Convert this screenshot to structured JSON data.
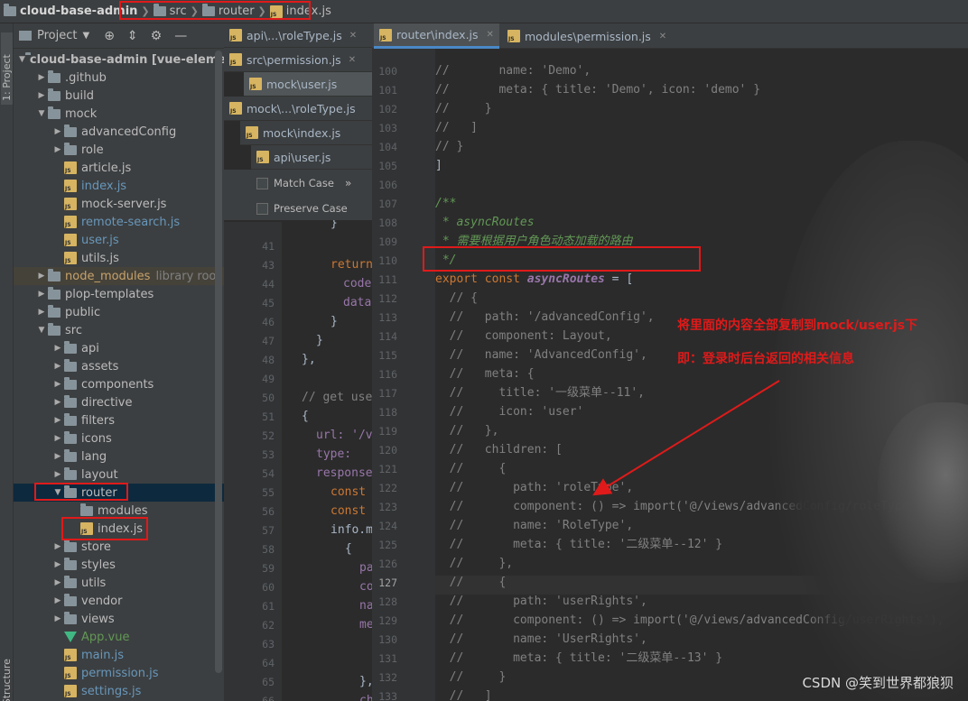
{
  "breadcrumb": {
    "project": "cloud-base-admin",
    "folders": [
      "src",
      "router"
    ],
    "file": "index.js"
  },
  "side_tabs": {
    "project": "1: Project",
    "structure": "Z: Structure"
  },
  "project_panel": {
    "title": "Project",
    "tools": [
      "⊕",
      "⇕",
      "⚙",
      "—"
    ],
    "tree": [
      {
        "label": "cloud-base-admin [vue-element-admin]",
        "depth": 0,
        "kind": "folder",
        "open": true,
        "bold": true
      },
      {
        "label": ".github",
        "depth": 1,
        "kind": "folder"
      },
      {
        "label": "build",
        "depth": 1,
        "kind": "folder"
      },
      {
        "label": "mock",
        "depth": 1,
        "kind": "folder",
        "open": true
      },
      {
        "label": "advancedConfig",
        "depth": 2,
        "kind": "folder"
      },
      {
        "label": "role",
        "depth": 2,
        "kind": "folder"
      },
      {
        "label": "article.js",
        "depth": 2,
        "kind": "js"
      },
      {
        "label": "index.js",
        "depth": 2,
        "kind": "js",
        "blue": true
      },
      {
        "label": "mock-server.js",
        "depth": 2,
        "kind": "js"
      },
      {
        "label": "remote-search.js",
        "depth": 2,
        "kind": "js",
        "blue": true
      },
      {
        "label": "user.js",
        "depth": 2,
        "kind": "js",
        "blue": true
      },
      {
        "label": "utils.js",
        "depth": 2,
        "kind": "js"
      },
      {
        "label": "node_modules",
        "depth": 1,
        "kind": "folder",
        "excluded": true,
        "suffix": "library root"
      },
      {
        "label": "plop-templates",
        "depth": 1,
        "kind": "folder"
      },
      {
        "label": "public",
        "depth": 1,
        "kind": "folder"
      },
      {
        "label": "src",
        "depth": 1,
        "kind": "folder",
        "open": true
      },
      {
        "label": "api",
        "depth": 2,
        "kind": "folder"
      },
      {
        "label": "assets",
        "depth": 2,
        "kind": "folder"
      },
      {
        "label": "components",
        "depth": 2,
        "kind": "folder"
      },
      {
        "label": "directive",
        "depth": 2,
        "kind": "folder"
      },
      {
        "label": "filters",
        "depth": 2,
        "kind": "folder"
      },
      {
        "label": "icons",
        "depth": 2,
        "kind": "folder"
      },
      {
        "label": "lang",
        "depth": 2,
        "kind": "folder"
      },
      {
        "label": "layout",
        "depth": 2,
        "kind": "folder"
      },
      {
        "label": "router",
        "depth": 2,
        "kind": "folder",
        "open": true,
        "selected": true
      },
      {
        "label": "modules",
        "depth": 3,
        "kind": "folder",
        "noarrow": true
      },
      {
        "label": "index.js",
        "depth": 3,
        "kind": "js"
      },
      {
        "label": "store",
        "depth": 2,
        "kind": "folder"
      },
      {
        "label": "styles",
        "depth": 2,
        "kind": "folder"
      },
      {
        "label": "utils",
        "depth": 2,
        "kind": "folder"
      },
      {
        "label": "vendor",
        "depth": 2,
        "kind": "folder"
      },
      {
        "label": "views",
        "depth": 2,
        "kind": "folder"
      },
      {
        "label": "App.vue",
        "depth": 2,
        "kind": "vue",
        "green": true
      },
      {
        "label": "main.js",
        "depth": 2,
        "kind": "js",
        "blue": true
      },
      {
        "label": "permission.js",
        "depth": 2,
        "kind": "js",
        "blue": true
      },
      {
        "label": "settings.js",
        "depth": 2,
        "kind": "js",
        "blue": true
      }
    ]
  },
  "mid_tabs": [
    {
      "label": "api\\...\\roleType.js"
    },
    {
      "label": "src\\permission.js"
    },
    {
      "label": "mock\\user.js",
      "active": true
    },
    {
      "label": "mock\\...\\roleType.js"
    },
    {
      "label": "mock\\index.js"
    },
    {
      "label": "api\\user.js"
    }
  ],
  "find_options": {
    "match_case": "Match Case",
    "preserve_case": "Preserve Case",
    "more": "»"
  },
  "mid_line_numbers": [
    "41",
    "43",
    "44",
    "45",
    "46",
    "47",
    "48",
    "49",
    "50",
    "51",
    "52",
    "53",
    "54",
    "55",
    "56",
    "57",
    "58",
    "59",
    "60",
    "61",
    "62",
    "63",
    "64",
    "65",
    "66"
  ],
  "mid_code": [
    "}",
    "return",
    "code",
    "data",
    "}",
    "}",
    "},",
    "// get use",
    "{",
    "url: '/v",
    "type: ",
    "response",
    "const",
    "const",
    "info.m",
    "{",
    "pa",
    "co",
    "na",
    "me",
    "},",
    "ch"
  ],
  "editor_tabs": [
    {
      "label": "router\\index.js",
      "active": true
    },
    {
      "label": "modules\\permission.js"
    }
  ],
  "line_numbers": [
    "100",
    "101",
    "102",
    "103",
    "104",
    "105",
    "106",
    "107",
    "108",
    "109",
    "110",
    "111",
    "112",
    "113",
    "114",
    "115",
    "116",
    "117",
    "118",
    "119",
    "120",
    "121",
    "122",
    "123",
    "124",
    "125",
    "126",
    "127",
    "128",
    "129",
    "130",
    "131",
    "132",
    "133",
    "134"
  ],
  "current_line": "127",
  "code_lines": [
    "//       name: 'Demo',",
    "//       meta: { title: 'Demo', icon: 'demo' }",
    "//     }",
    "//   ]",
    "// }",
    "]",
    "",
    "/**",
    " * asyncRoutes",
    " * 需要根据用户角色动态加载的路由",
    " */",
    "export const asyncRoutes = [",
    "  // {",
    "  //   path: '/advancedConfig',",
    "  //   component: Layout,",
    "  //   name: 'AdvancedConfig',",
    "  //   meta: {",
    "  //     title: '一级菜单--11',",
    "  //     icon: 'user'",
    "  //   },",
    "  //   children: [",
    "  //     {",
    "  //       path: 'roleType',",
    "  //       component: () => import('@/views/advancedConfig/roleType'),",
    "  //       name: 'RoleType',",
    "  //       meta: { title: '二级菜单--12' }",
    "  //     },",
    "  //     {",
    "  //       path: 'userRights',",
    "  //       component: () => import('@/views/advancedConfig/userRights'),",
    "  //       name: 'UserRights',",
    "  //       meta: { title: '二级菜单--13' }",
    "  //     }",
    "  //   ]",
    "  // },"
  ],
  "annotations": {
    "line1": "将里面的内容全部复制到mock/user.js下",
    "line2": "即：登录时后台返回的相关信息"
  },
  "watermark": "CSDN @笑到世界都狼狈",
  "colors": {
    "highlight_box": "#e01a1a",
    "keyword": "#cc7832",
    "comment": "#808080",
    "doc_comment": "#629755"
  }
}
